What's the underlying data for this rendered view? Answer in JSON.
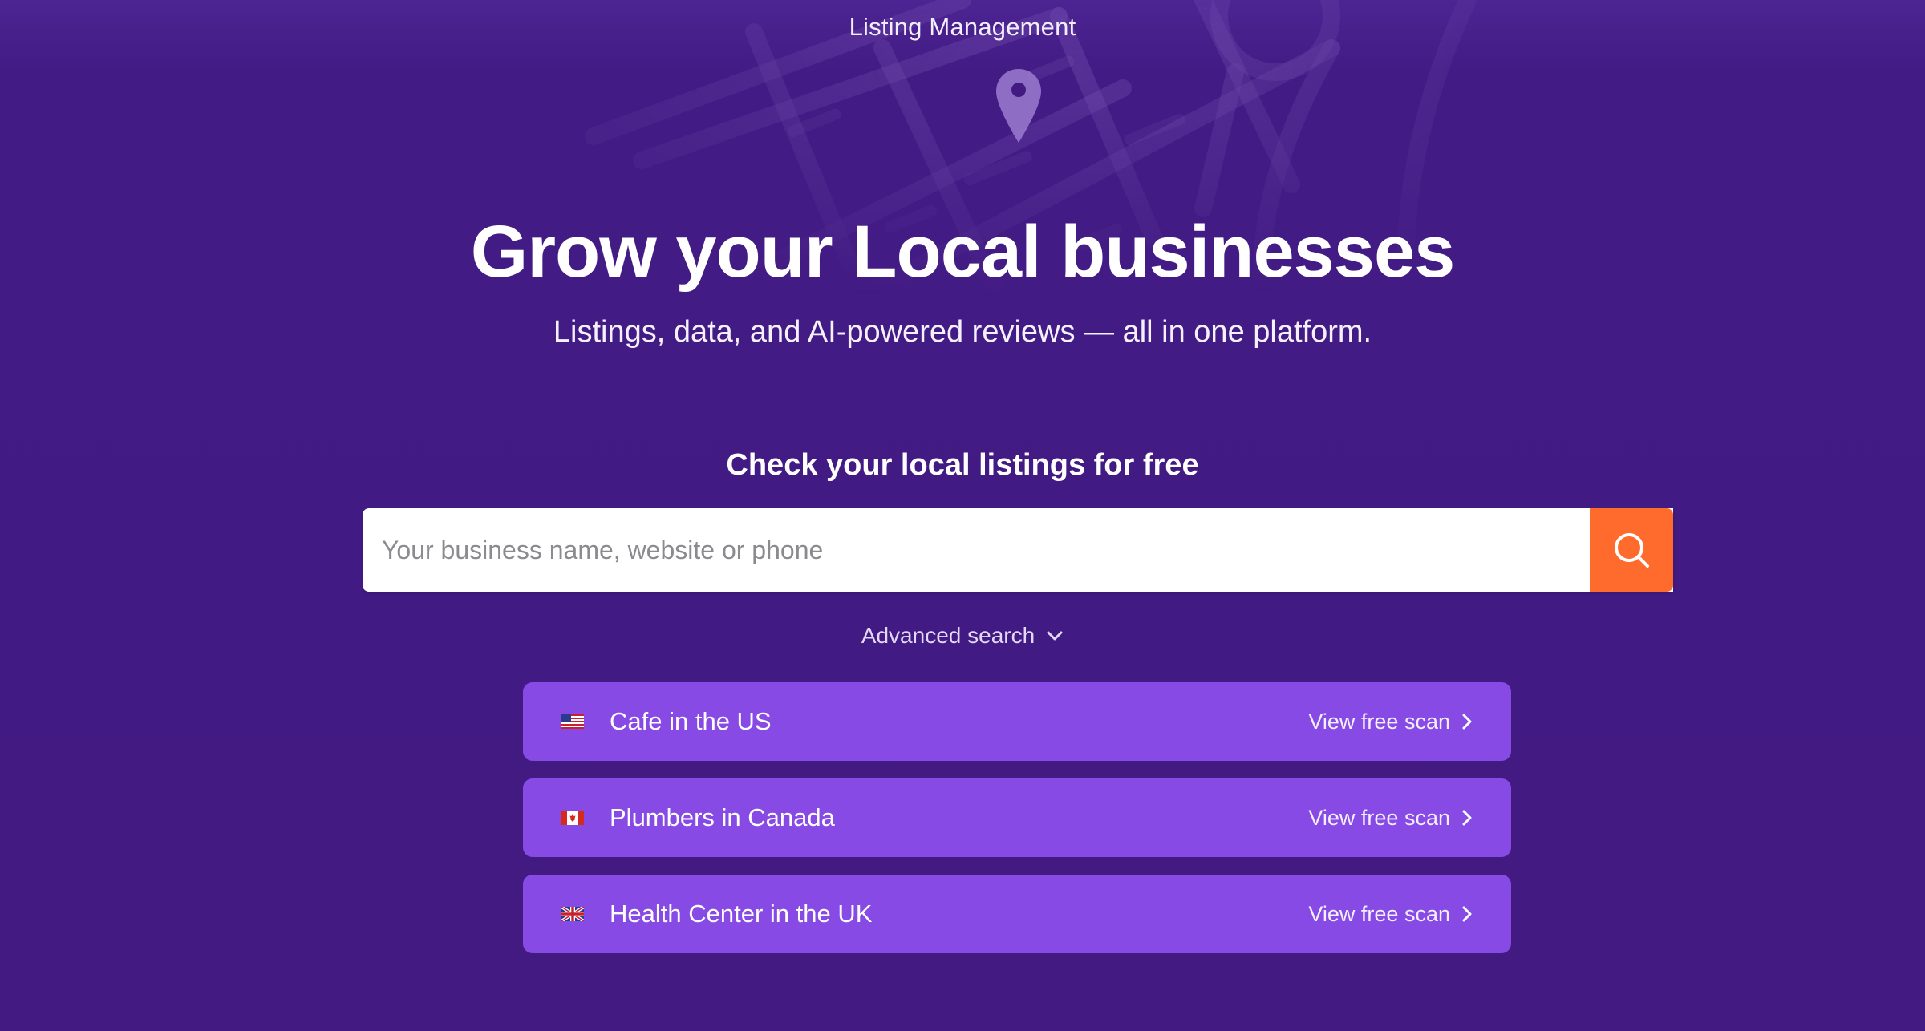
{
  "header": {
    "eyebrow": "Listing Management"
  },
  "hero": {
    "headline": "Grow your Local businesses",
    "subhead": "Listings, data, and AI-powered reviews — all in one platform."
  },
  "search": {
    "title": "Check your local listings for free",
    "placeholder": "Your business name, website or phone",
    "value": "",
    "button_icon": "search-icon",
    "advanced_label": "Advanced search"
  },
  "scans": [
    {
      "flag": "us-flag-icon",
      "label": "Cafe in the US",
      "cta": "View free scan"
    },
    {
      "flag": "ca-flag-icon",
      "label": "Plumbers in Canada",
      "cta": "View free scan"
    },
    {
      "flag": "uk-flag-icon",
      "label": "Health Center in the UK",
      "cta": "View free scan"
    }
  ],
  "colors": {
    "background": "#421a82",
    "search_button": "#ff6b2c",
    "scan_card": "#874ae4"
  }
}
